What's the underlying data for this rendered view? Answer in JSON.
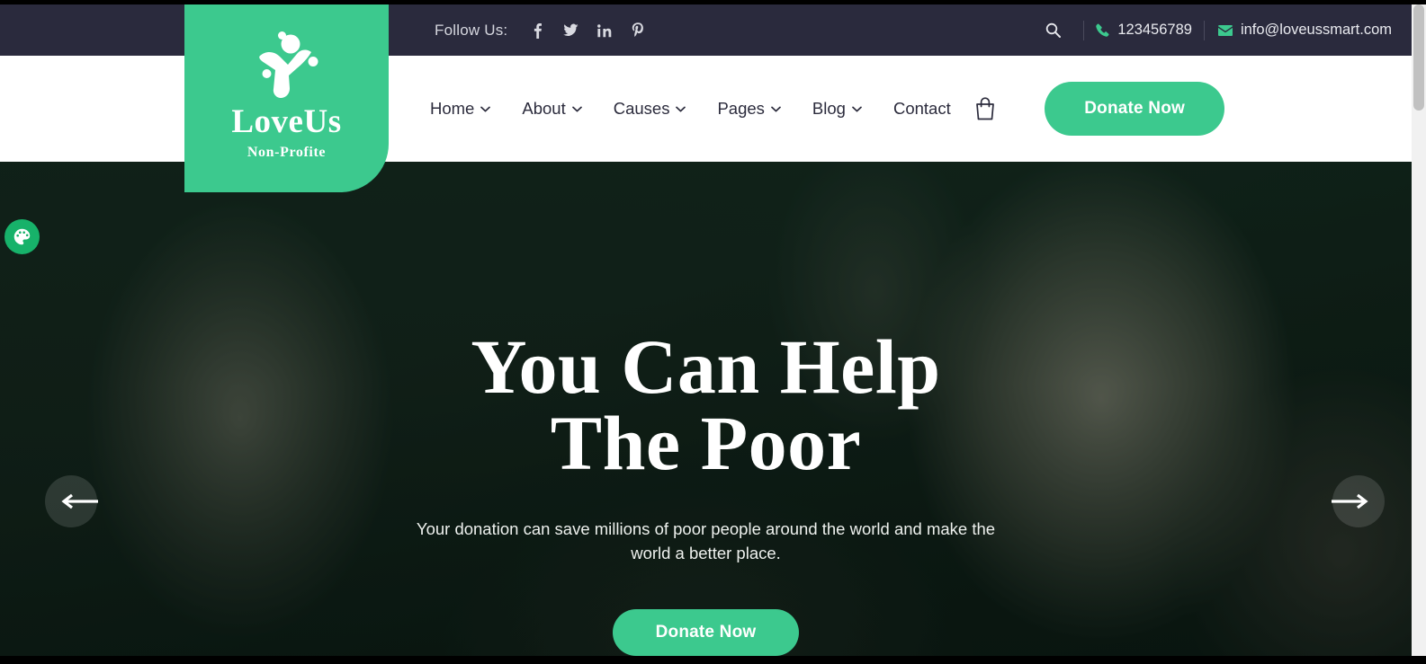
{
  "colors": {
    "brand_green": "#3cc98e",
    "topbar_bg": "#2a2a3d",
    "nav_bg": "#ffffff",
    "nav_text": "#2b2b3c",
    "hero_text": "#ffffff"
  },
  "topbar": {
    "follow_label": "Follow Us:",
    "social": [
      {
        "name": "facebook-icon",
        "title": "Facebook"
      },
      {
        "name": "twitter-icon",
        "title": "Twitter"
      },
      {
        "name": "linkedin-icon",
        "title": "LinkedIn"
      },
      {
        "name": "pinterest-icon",
        "title": "Pinterest"
      }
    ],
    "search_icon": "search-icon",
    "phone_icon": "phone-icon",
    "phone": "123456789",
    "email_icon": "envelope-icon",
    "email": "info@loveussmart.com"
  },
  "logo": {
    "name": "LoveUs",
    "tagline": "Non-Profite",
    "mark": "person-star-logo-icon"
  },
  "nav": {
    "items": [
      {
        "label": "Home",
        "has_dropdown": true
      },
      {
        "label": "About",
        "has_dropdown": true
      },
      {
        "label": "Causes",
        "has_dropdown": true
      },
      {
        "label": "Pages",
        "has_dropdown": true
      },
      {
        "label": "Blog",
        "has_dropdown": true
      },
      {
        "label": "Contact",
        "has_dropdown": false
      }
    ],
    "cart_icon": "shopping-bag-icon",
    "donate_label": "Donate Now"
  },
  "hero": {
    "title_line1": "You Can Help",
    "title_line2": "The Poor",
    "subtitle": "Your donation can save millions of poor people around the world and make the world a better place.",
    "donate_label": "Donate Now",
    "prev_icon": "arrow-left-icon",
    "next_icon": "arrow-right-icon"
  },
  "widgets": {
    "palette_icon": "palette-icon"
  }
}
